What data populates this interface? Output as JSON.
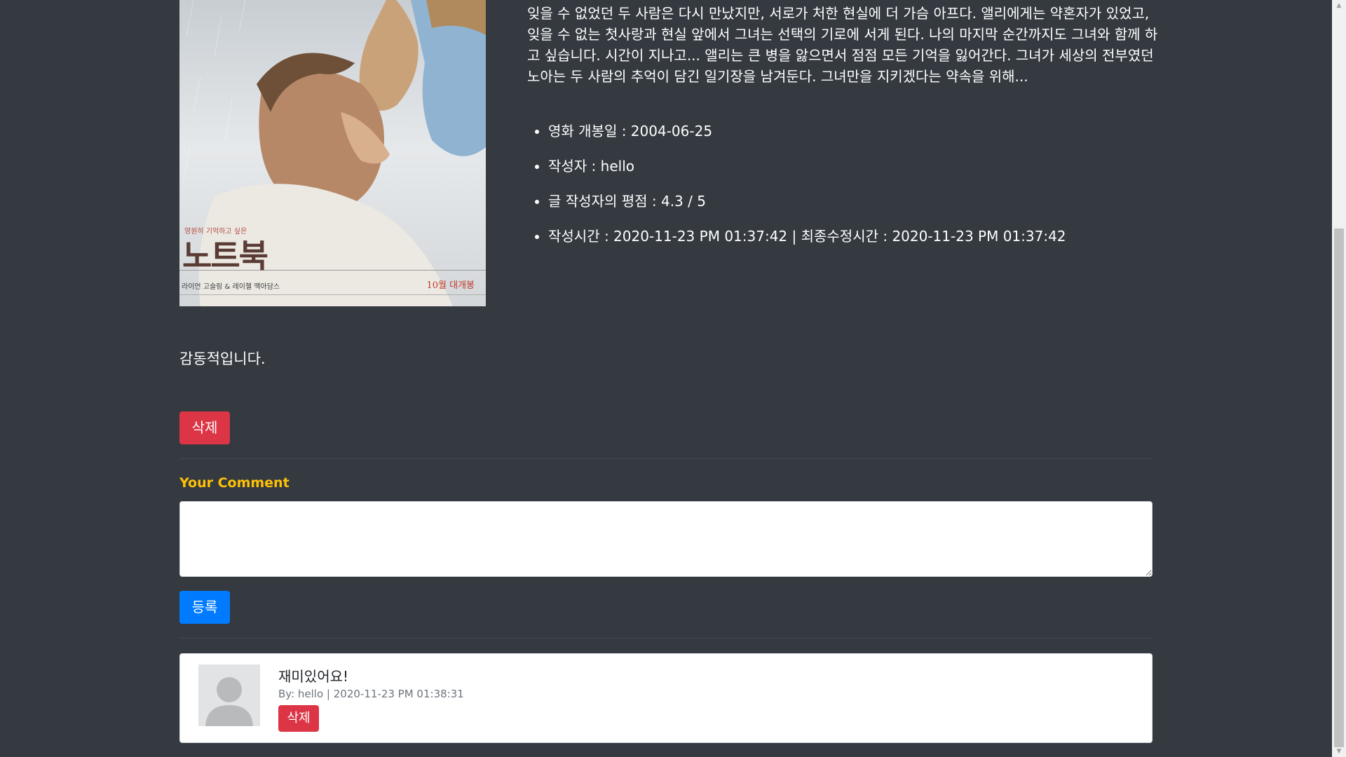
{
  "post": {
    "synopsis": "잊을 수 없었던 두 사람은 다시 만났지만, 서로가 처한 현실에 더 가슴 아프다. 앨리에게는 약혼자가 있었고, 잊을 수 없는 첫사랑과 현실 앞에서 그녀는 선택의 기로에 서게 된다. 나의 마지막 순간까지도 그녀와 함께 하고 싶습니다. 시간이 지나고... 앨리는 큰 병을 앓으면서 점점 모든 기억을 잃어간다. 그녀가 세상의 전부였던 노아는 두 사람의 추억이 담긴 일기장을 남겨둔다. 그녀만을 지키겠다는 약속을 위해...",
    "info": {
      "release": "영화 개봉일 : 2004-06-25",
      "author": "작성자 : hello",
      "rating": "글 작성자의 평점 : 4.3 / 5",
      "times": "작성시간 : 2020-11-23 PM 01:37:42 | 최종수정시간 : 2020-11-23 PM 01:37:42"
    },
    "body": "감동적입니다.",
    "delete_label": "삭제"
  },
  "poster": {
    "tagline": "영원히 기억하고 싶은",
    "title": "노트북",
    "cast": "라이언 고슬링 & 레이첼 맥아담스",
    "release": "10월 대개봉"
  },
  "comment_form": {
    "label": "Your Comment",
    "value": "",
    "submit_label": "등록"
  },
  "comments": [
    {
      "text": "재미있어요!",
      "meta": "By: hello | 2020-11-23 PM 01:38:31",
      "delete_label": "삭제"
    }
  ],
  "colors": {
    "background": "#343a40",
    "accent_label": "#ffc107",
    "danger": "#dc3545",
    "primary": "#007bff"
  }
}
